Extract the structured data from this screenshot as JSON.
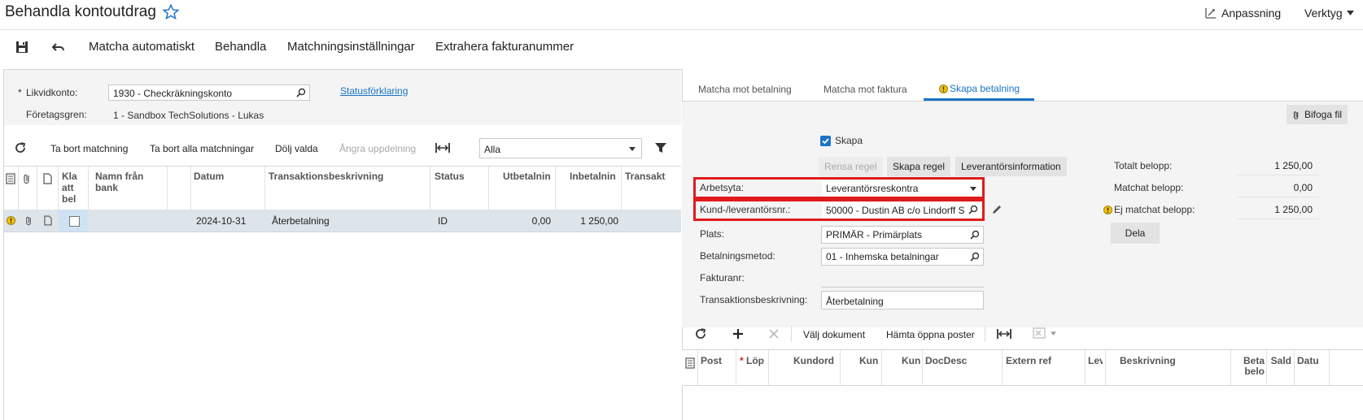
{
  "page": {
    "title": "Behandla kontoutdrag",
    "customize_label": "Anpassning",
    "tools_label": "Verktyg"
  },
  "toolbar": {
    "auto_match": "Matcha automatiskt",
    "process": "Behandla",
    "match_settings": "Matchningsinställningar",
    "extract_invoice": "Extrahera fakturanummer"
  },
  "left_form": {
    "cash_account_label": "Likvidkonto:",
    "cash_account_value": "1930 - Checkräkningskonto",
    "branch_label": "Företagsgren:",
    "branch_value": "1 - Sandbox TechSolutions - Lukas",
    "status_link": "Statusförklaring"
  },
  "left_grid_toolbar": {
    "remove_match": "Ta bort matchning",
    "remove_all_matches": "Ta bort alla matchningar",
    "hide_selected": "Dölj valda",
    "undo_split": "Ångra uppdelning",
    "filter_value": "Alla"
  },
  "left_grid": {
    "headers": {
      "ready": "Kla att bel",
      "bank_name": "Namn från bank",
      "date": "Datum",
      "description": "Transaktionsbeskrivning",
      "status": "Status",
      "payments_out": "Utbetalnin",
      "payments_in": "Inbetalnin",
      "transaction": "Transakt"
    },
    "rows": [
      {
        "bank_name": "",
        "date": "2024-10-31",
        "description": "Återbetalning",
        "status": "ID",
        "payments_out": "0,00",
        "payments_in": "1 250,00"
      }
    ]
  },
  "tabs": {
    "match_payment": "Matcha mot betalning",
    "match_invoice": "Matcha mot faktura",
    "create_payment": "Skapa betalning"
  },
  "right": {
    "attach_file": "Bifoga fil",
    "create_label": "Skapa",
    "clear_rule": "Rensa regel",
    "create_rule": "Skapa regel",
    "vendor_info": "Leverantörsinformation",
    "workspace_label": "Arbetsyta:",
    "workspace_value": "Leverantörsreskontra",
    "customer_vendor_label": "Kund-/leverantörsnr.:",
    "customer_vendor_value": "50000 - Dustin AB c/o Lindorff S",
    "location_label": "Plats:",
    "location_value": "PRIMÄR - Primärplats",
    "payment_method_label": "Betalningsmetod:",
    "payment_method_value": "01 - Inhemska betalningar",
    "invoice_no_label": "Fakturanr:",
    "trans_desc_label": "Transaktionsbeskrivning:",
    "trans_desc_value": "Återbetalning",
    "total_label": "Totalt belopp:",
    "total_value": "1 250,00",
    "matched_label": "Matchat belopp:",
    "matched_value": "0,00",
    "unmatched_label": "Ej matchat belopp:",
    "unmatched_value": "1 250,00",
    "split_button": "Dela"
  },
  "right_grid_toolbar": {
    "select_document": "Välj dokument",
    "fetch_open_items": "Hämta öppna poster"
  },
  "right_grid": {
    "headers": {
      "post": "Post",
      "lop": "Löp",
      "kundord": "Kundord",
      "kun1": "Kun",
      "kun2": "Kun",
      "docdesc": "DocDesc",
      "extref": "Extern ref",
      "lev": "Lev",
      "beskrivning": "Beskrivning",
      "beta": "Beta belo",
      "sald": "Sald",
      "datu": "Datu"
    }
  },
  "colors": {
    "accent": "#1a73c7",
    "highlight_box": "#e01b1b",
    "warning": "#f2c200"
  }
}
